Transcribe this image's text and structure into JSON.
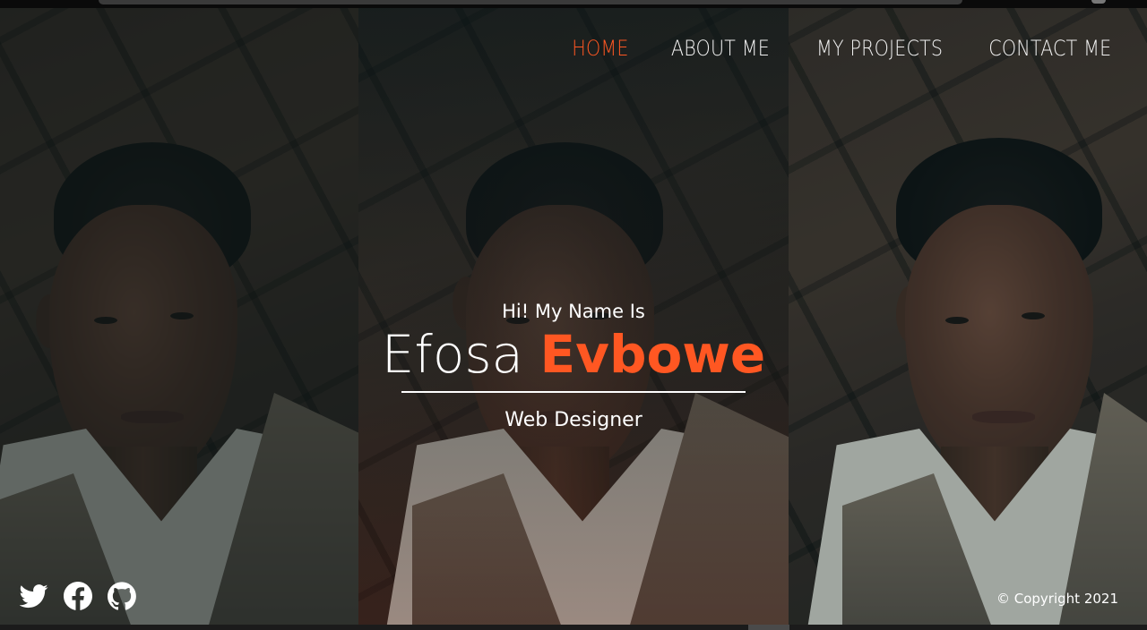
{
  "nav": {
    "items": [
      {
        "label": "HOME",
        "active": true
      },
      {
        "label": "ABOUT ME",
        "active": false
      },
      {
        "label": "MY PROJECTS",
        "active": false
      },
      {
        "label": "CONTACT ME",
        "active": false
      }
    ]
  },
  "hero": {
    "greeting": "Hi! My Name Is",
    "first_name": "Efosa",
    "last_name": "Evbowe",
    "role": "Web Designer"
  },
  "socials": [
    {
      "icon": "twitter-icon"
    },
    {
      "icon": "facebook-icon"
    },
    {
      "icon": "github-icon"
    }
  ],
  "footer": {
    "copyright": "© Copyright 2021"
  },
  "colors": {
    "accent": "#ff5722",
    "text": "#ffffff"
  }
}
